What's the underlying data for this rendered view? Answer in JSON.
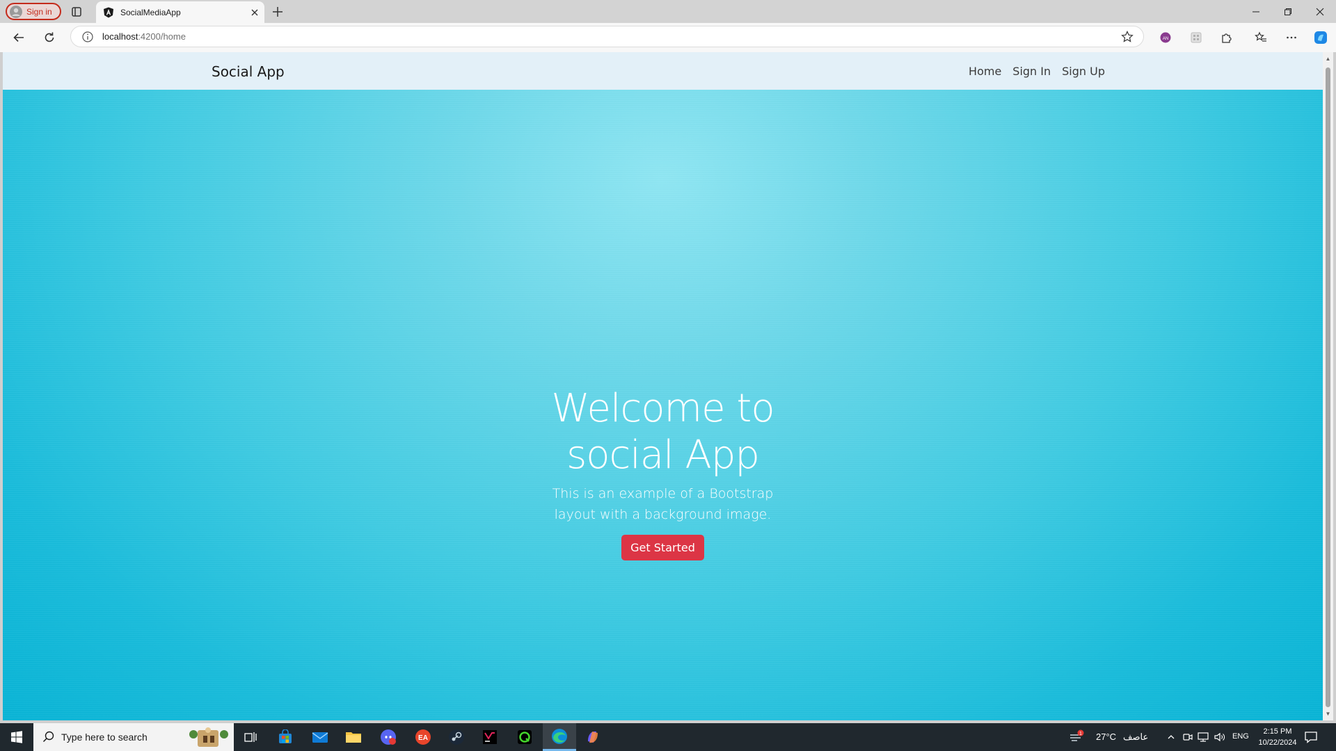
{
  "browser": {
    "profile_label": "Sign in",
    "tab_title": "SocialMediaApp",
    "url_host": "localhost",
    "url_rest": ":4200/home"
  },
  "site": {
    "brand": "Social App",
    "nav": [
      {
        "label": "Home"
      },
      {
        "label": "Sign In"
      },
      {
        "label": "Sign Up"
      }
    ],
    "hero": {
      "title": "Welcome to social App",
      "subtitle": "This is an example of a Bootstrap layout with a background image.",
      "cta_label": "Get Started"
    }
  },
  "taskbar": {
    "search_placeholder": "Type here to search",
    "weather": "27°C",
    "weather_text": "عاصف",
    "language": "ENG",
    "time": "2:15 PM",
    "date": "10/22/2024",
    "badge": "1"
  },
  "colors": {
    "cta": "#dc3545",
    "navbar_bg": "#e3f0f8",
    "hero_top": "#8fe6f3",
    "hero_bottom": "#08b4d6",
    "taskbar_bg": "#20282e"
  }
}
